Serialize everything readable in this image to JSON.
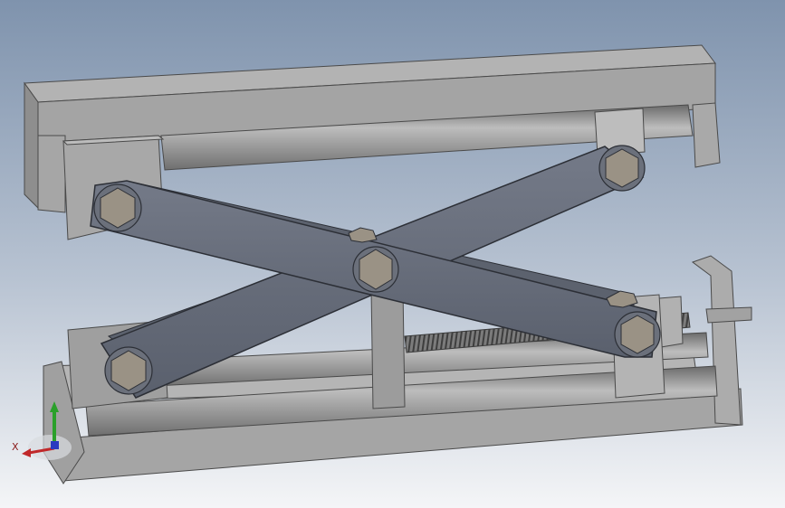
{
  "viewport": {
    "background_top": "#7f93ad",
    "background_bottom": "#f4f5f7"
  },
  "model": {
    "frame_color": "#a9a9a9",
    "frame_edge": "#4a4a4a",
    "rod_color": "#8d8d8d",
    "arm_color": "#646a77",
    "arm_edge": "#2c2f36",
    "bolt_color": "#9a9285",
    "screw_color": "#7a7a7a"
  },
  "triad": {
    "x_label": "X",
    "x_color": "#c0282a",
    "y_color": "#2aa02a",
    "z_color": "#2a3ac0",
    "icon": "coordinate-axes-icon"
  }
}
